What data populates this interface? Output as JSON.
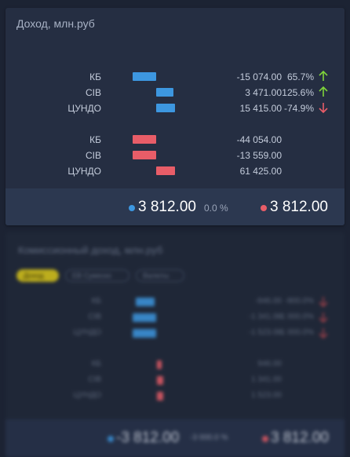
{
  "income_card": {
    "title": "Доход, млн.руб",
    "blue_rows": [
      {
        "label": "КБ",
        "value": "-15 074.00",
        "pct": "65.7%",
        "trend": "up"
      },
      {
        "label": "CIB",
        "value": "3 471.00",
        "pct": "125.6%",
        "trend": "up"
      },
      {
        "label": "ЦУНДО",
        "value": "15 415.00",
        "pct": "-74.9%",
        "trend": "down"
      }
    ],
    "red_rows": [
      {
        "label": "КБ",
        "value": "-44 054.00"
      },
      {
        "label": "CIB",
        "value": "-13 559.00"
      },
      {
        "label": "ЦУНДО",
        "value": "61 425.00"
      }
    ],
    "footer": {
      "blue_total": "3 812.00",
      "blue_pct": "0.0 %",
      "red_total": "3 812.00"
    }
  },
  "commission_card": {
    "title": "Комиссионный доход, млн.руб",
    "chips": [
      "Доход",
      "ЕВ Сумеско",
      "Валюты"
    ],
    "blue_rows": [
      {
        "label": "КБ",
        "value": "-946.00",
        "pct": "-900.0%"
      },
      {
        "label": "CIB",
        "value": "-1 341.00",
        "pct": "-1 000.0%"
      },
      {
        "label": "ЦУНДО",
        "value": "-1 523.00",
        "pct": "-1 000.0%"
      }
    ],
    "red_rows": [
      {
        "label": "КБ",
        "value": "946.00"
      },
      {
        "label": "CIB",
        "value": "1 341.00"
      },
      {
        "label": "ЦУНДО",
        "value": "1 523.00"
      }
    ],
    "footer": {
      "blue_total": "-3 812.00",
      "blue_pct": "-3 000.0 %",
      "red_total": "3 812.00"
    }
  },
  "colors": {
    "blue": "#3d97e0",
    "red": "#e85d68",
    "up_arrow": "#7fd43a",
    "down_arrow": "#e85d68",
    "chip_active": "#d9c61a"
  }
}
